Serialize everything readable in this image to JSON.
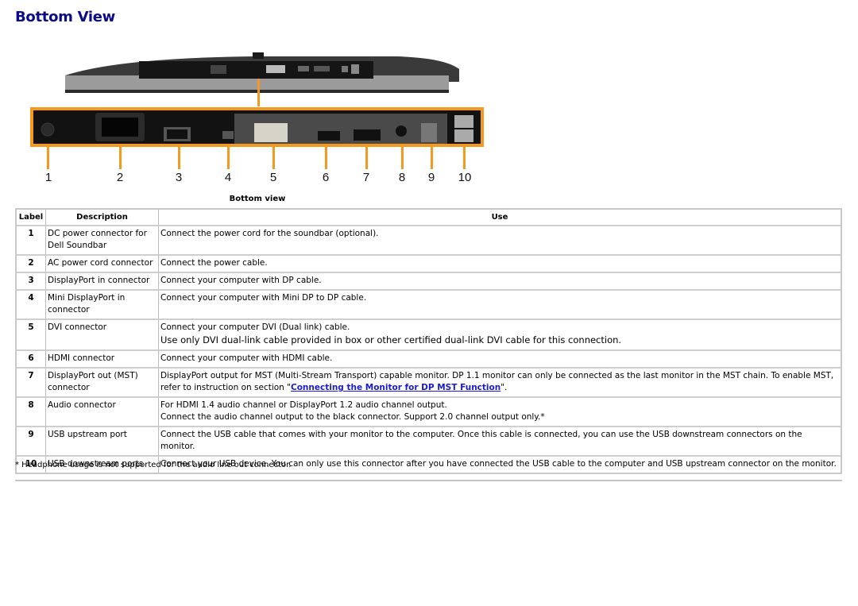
{
  "page": {
    "title": "Bottom View",
    "figure_caption": "Bottom view",
    "figure_labels": [
      "1",
      "2",
      "3",
      "4",
      "5",
      "6",
      "7",
      "8",
      "9",
      "10"
    ]
  },
  "colors": {
    "title": "#0b0b8a",
    "callout": "#f39a1e",
    "link": "#1a1ad4"
  },
  "table": {
    "headers": {
      "label": "Label",
      "description": "Description",
      "use": "Use"
    },
    "rows": [
      {
        "label": "1",
        "description": "DC power connector for Dell Soundbar",
        "use": [
          "Connect the power cord for the soundbar (optional)."
        ]
      },
      {
        "label": "2",
        "description": "AC power cord connector",
        "use": [
          "Connect the power cable."
        ]
      },
      {
        "label": "3",
        "description": "DisplayPort in connector",
        "use": [
          "Connect your computer with DP cable."
        ]
      },
      {
        "label": "4",
        "description": "Mini DisplayPort in connector",
        "use": [
          "Connect your computer with Mini DP to DP cable."
        ]
      },
      {
        "label": "5",
        "description": "DVI connector",
        "use": [
          "Connect your computer DVI (Dual link) cable.",
          "Use only DVI dual-link cable provided in box or other certified dual-link DVI cable for this connection."
        ]
      },
      {
        "label": "6",
        "description": "HDMI connector",
        "use": [
          "Connect your computer with HDMI cable."
        ]
      },
      {
        "label": "7",
        "description": "DisplayPort out (MST) connector",
        "use": [
          "DisplayPort output for MST (Multi-Stream Transport) capable monitor. DP 1.1 monitor can only be connected as the last monitor in the MST chain. To enable MST,"
        ],
        "use_link_prefix": "refer to instruction on section \"",
        "use_link": "Connecting the Monitor for DP MST Function",
        "use_link_suffix": "\"."
      },
      {
        "label": "8",
        "description": "Audio connector",
        "use": [
          "For HDMI 1.4 audio channel or DisplayPort 1.2 audio channel output.",
          "Connect the audio channel output to the black connector. Support 2.0 channel output only.*"
        ]
      },
      {
        "label": "9",
        "description": "USB upstream port",
        "use": [
          "Connect the USB cable that comes with your monitor to the computer. Once this cable is connected, you can use the USB downstream connectors on the monitor."
        ]
      },
      {
        "label": "10",
        "description": "USB downstream ports",
        "use": [
          "Connect your USB device. You can only use this connector after you have connected the USB cable to the computer and USB upstream connector on the monitor."
        ]
      }
    ]
  },
  "footnote": "* Headphone usage is not supported for the audio line out connector."
}
